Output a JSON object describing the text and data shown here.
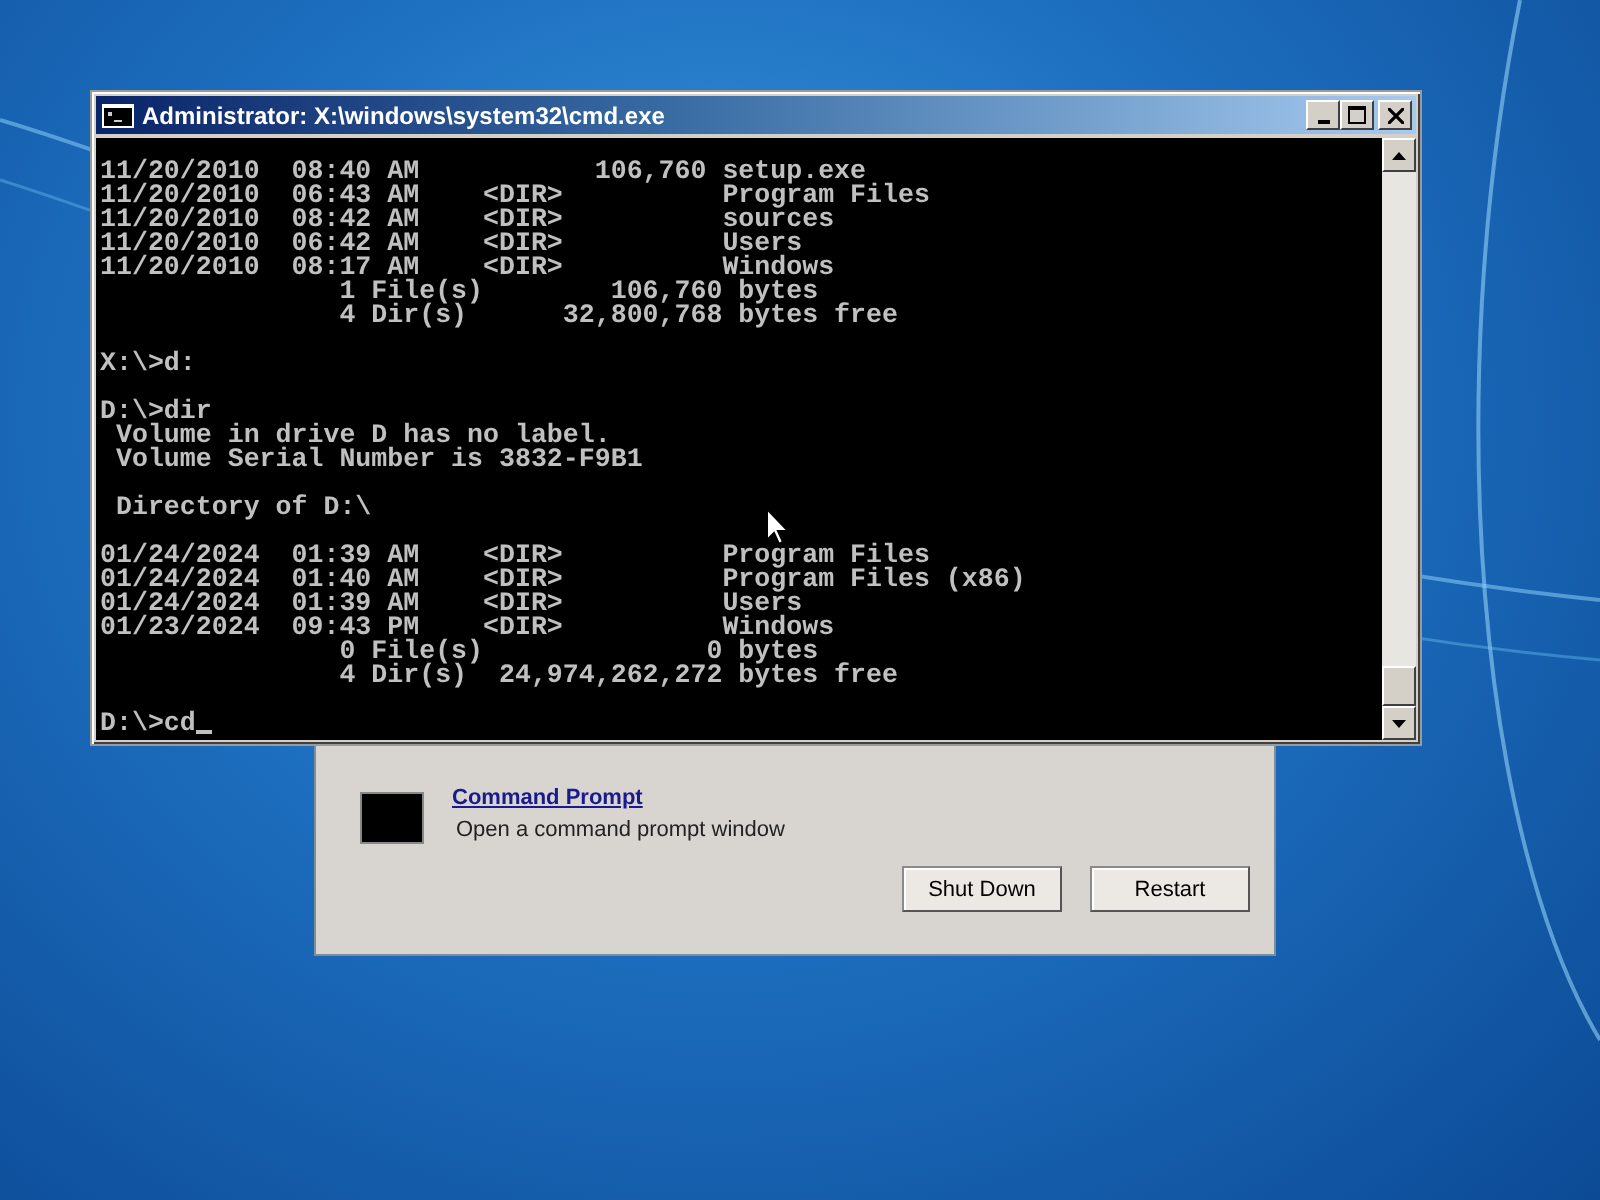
{
  "window": {
    "title": "Administrator: X:\\windows\\system32\\cmd.exe"
  },
  "console": {
    "blocks": [
      [
        "11/20/2010  08:40 AM           106,760 setup.exe",
        "11/20/2010  06:43 AM    <DIR>          Program Files",
        "11/20/2010  08:42 AM    <DIR>          sources",
        "11/20/2010  06:42 AM    <DIR>          Users",
        "11/20/2010  08:17 AM    <DIR>          Windows",
        "               1 File(s)        106,760 bytes",
        "               4 Dir(s)      32,800,768 bytes free"
      ],
      [
        "X:\\>d:"
      ],
      [
        "D:\\>dir",
        " Volume in drive D has no label.",
        " Volume Serial Number is 3832-F9B1"
      ],
      [
        " Directory of D:\\"
      ],
      [
        "01/24/2024  01:39 AM    <DIR>          Program Files",
        "01/24/2024  01:40 AM    <DIR>          Program Files (x86)",
        "01/24/2024  01:39 AM    <DIR>          Users",
        "01/23/2024  09:43 PM    <DIR>          Windows",
        "               0 File(s)              0 bytes",
        "               4 Dir(s)  24,974,262,272 bytes free"
      ],
      [
        "D:\\>cd"
      ]
    ]
  },
  "dialog": {
    "tool": {
      "title": "Command Prompt",
      "description": "Open a command prompt window"
    },
    "buttons": [
      "Shut Down",
      "Restart"
    ]
  }
}
